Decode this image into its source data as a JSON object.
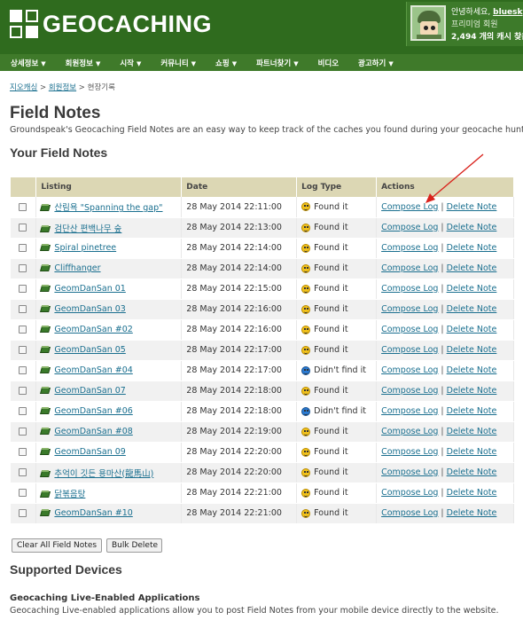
{
  "header": {
    "logo_text": "GEOCACHING",
    "user": {
      "greeting": "안녕하세요, ",
      "name": "bluesky",
      "membership": "프리미엄 회원",
      "finds": "2,494 개의 캐시 찾음"
    }
  },
  "nav": {
    "items": [
      {
        "label": "상세정보"
      },
      {
        "label": "회원정보"
      },
      {
        "label": "시작"
      },
      {
        "label": "커뮤니티"
      },
      {
        "label": "쇼핑"
      },
      {
        "label": "파트너찾기"
      },
      {
        "label": "비디오"
      },
      {
        "label": "광고하기"
      }
    ]
  },
  "breadcrumb": {
    "home": "지오캐싱",
    "account": "회원정보",
    "separator": ">",
    "current": "현장기록"
  },
  "page": {
    "title": "Field Notes",
    "intro": "Groundspeak's Geocaching Field Notes are an easy way to keep track of the caches you found during your geocache hunts.",
    "section_title": "Your Field Notes"
  },
  "table": {
    "headers": {
      "listing": "Listing",
      "date": "Date",
      "log_type": "Log Type",
      "actions": "Actions"
    },
    "action_compose": "Compose Log",
    "action_separator": "|",
    "action_delete": "Delete Note",
    "rows": [
      {
        "listing": "산림욕 \"Spanning the gap\"",
        "date": "28 May 2014 22:11:00",
        "log_type": "Found it",
        "type_icon": "found-smiley"
      },
      {
        "listing": "검단산 편백나무 숲",
        "date": "28 May 2014 22:13:00",
        "log_type": "Found it",
        "type_icon": "found-smiley"
      },
      {
        "listing": "Spiral pinetree",
        "date": "28 May 2014 22:14:00",
        "log_type": "Found it",
        "type_icon": "found-smiley"
      },
      {
        "listing": "Cliffhanger",
        "date": "28 May 2014 22:14:00",
        "log_type": "Found it",
        "type_icon": "found-smiley"
      },
      {
        "listing": "GeomDanSan 01",
        "date": "28 May 2014 22:15:00",
        "log_type": "Found it",
        "type_icon": "found-smiley"
      },
      {
        "listing": "GeomDanSan 03",
        "date": "28 May 2014 22:16:00",
        "log_type": "Found it",
        "type_icon": "found-smiley"
      },
      {
        "listing": "GeomDanSan #02",
        "date": "28 May 2014 22:16:00",
        "log_type": "Found it",
        "type_icon": "found-smiley"
      },
      {
        "listing": "GeomDanSan 05",
        "date": "28 May 2014 22:17:00",
        "log_type": "Found it",
        "type_icon": "found-smiley"
      },
      {
        "listing": "GeomDanSan #04",
        "date": "28 May 2014 22:17:00",
        "log_type": "Didn't find it",
        "type_icon": "dnf-smiley"
      },
      {
        "listing": "GeomDanSan 07",
        "date": "28 May 2014 22:18:00",
        "log_type": "Found it",
        "type_icon": "found-smiley"
      },
      {
        "listing": "GeomDanSan #06",
        "date": "28 May 2014 22:18:00",
        "log_type": "Didn't find it",
        "type_icon": "dnf-smiley"
      },
      {
        "listing": "GeomDanSan #08",
        "date": "28 May 2014 22:19:00",
        "log_type": "Found it",
        "type_icon": "found-smiley"
      },
      {
        "listing": "GeomDanSan 09",
        "date": "28 May 2014 22:20:00",
        "log_type": "Found it",
        "type_icon": "found-smiley"
      },
      {
        "listing": "추억이 깃든 용마산(龍馬山)",
        "date": "28 May 2014 22:20:00",
        "log_type": "Found it",
        "type_icon": "found-smiley"
      },
      {
        "listing": "닭볶음탕",
        "date": "28 May 2014 22:21:00",
        "log_type": "Found it",
        "type_icon": "found-smiley"
      },
      {
        "listing": "GeomDanSan #10",
        "date": "28 May 2014 22:21:00",
        "log_type": "Found it",
        "type_icon": "found-smiley"
      }
    ]
  },
  "buttons": {
    "clear_all": "Clear All Field Notes",
    "bulk_delete": "Bulk Delete"
  },
  "devices": {
    "title": "Supported Devices",
    "live_title": "Geocaching Live-Enabled Applications",
    "live_desc": "Geocaching Live-enabled applications allow you to post Field Notes from your mobile device directly to the website."
  },
  "colors": {
    "header_green": "#2f6b1e",
    "nav_green": "#3f7a2a",
    "table_header": "#dcd7b4",
    "link": "#1a6f8f",
    "annotation_arrow": "#d9221c"
  }
}
